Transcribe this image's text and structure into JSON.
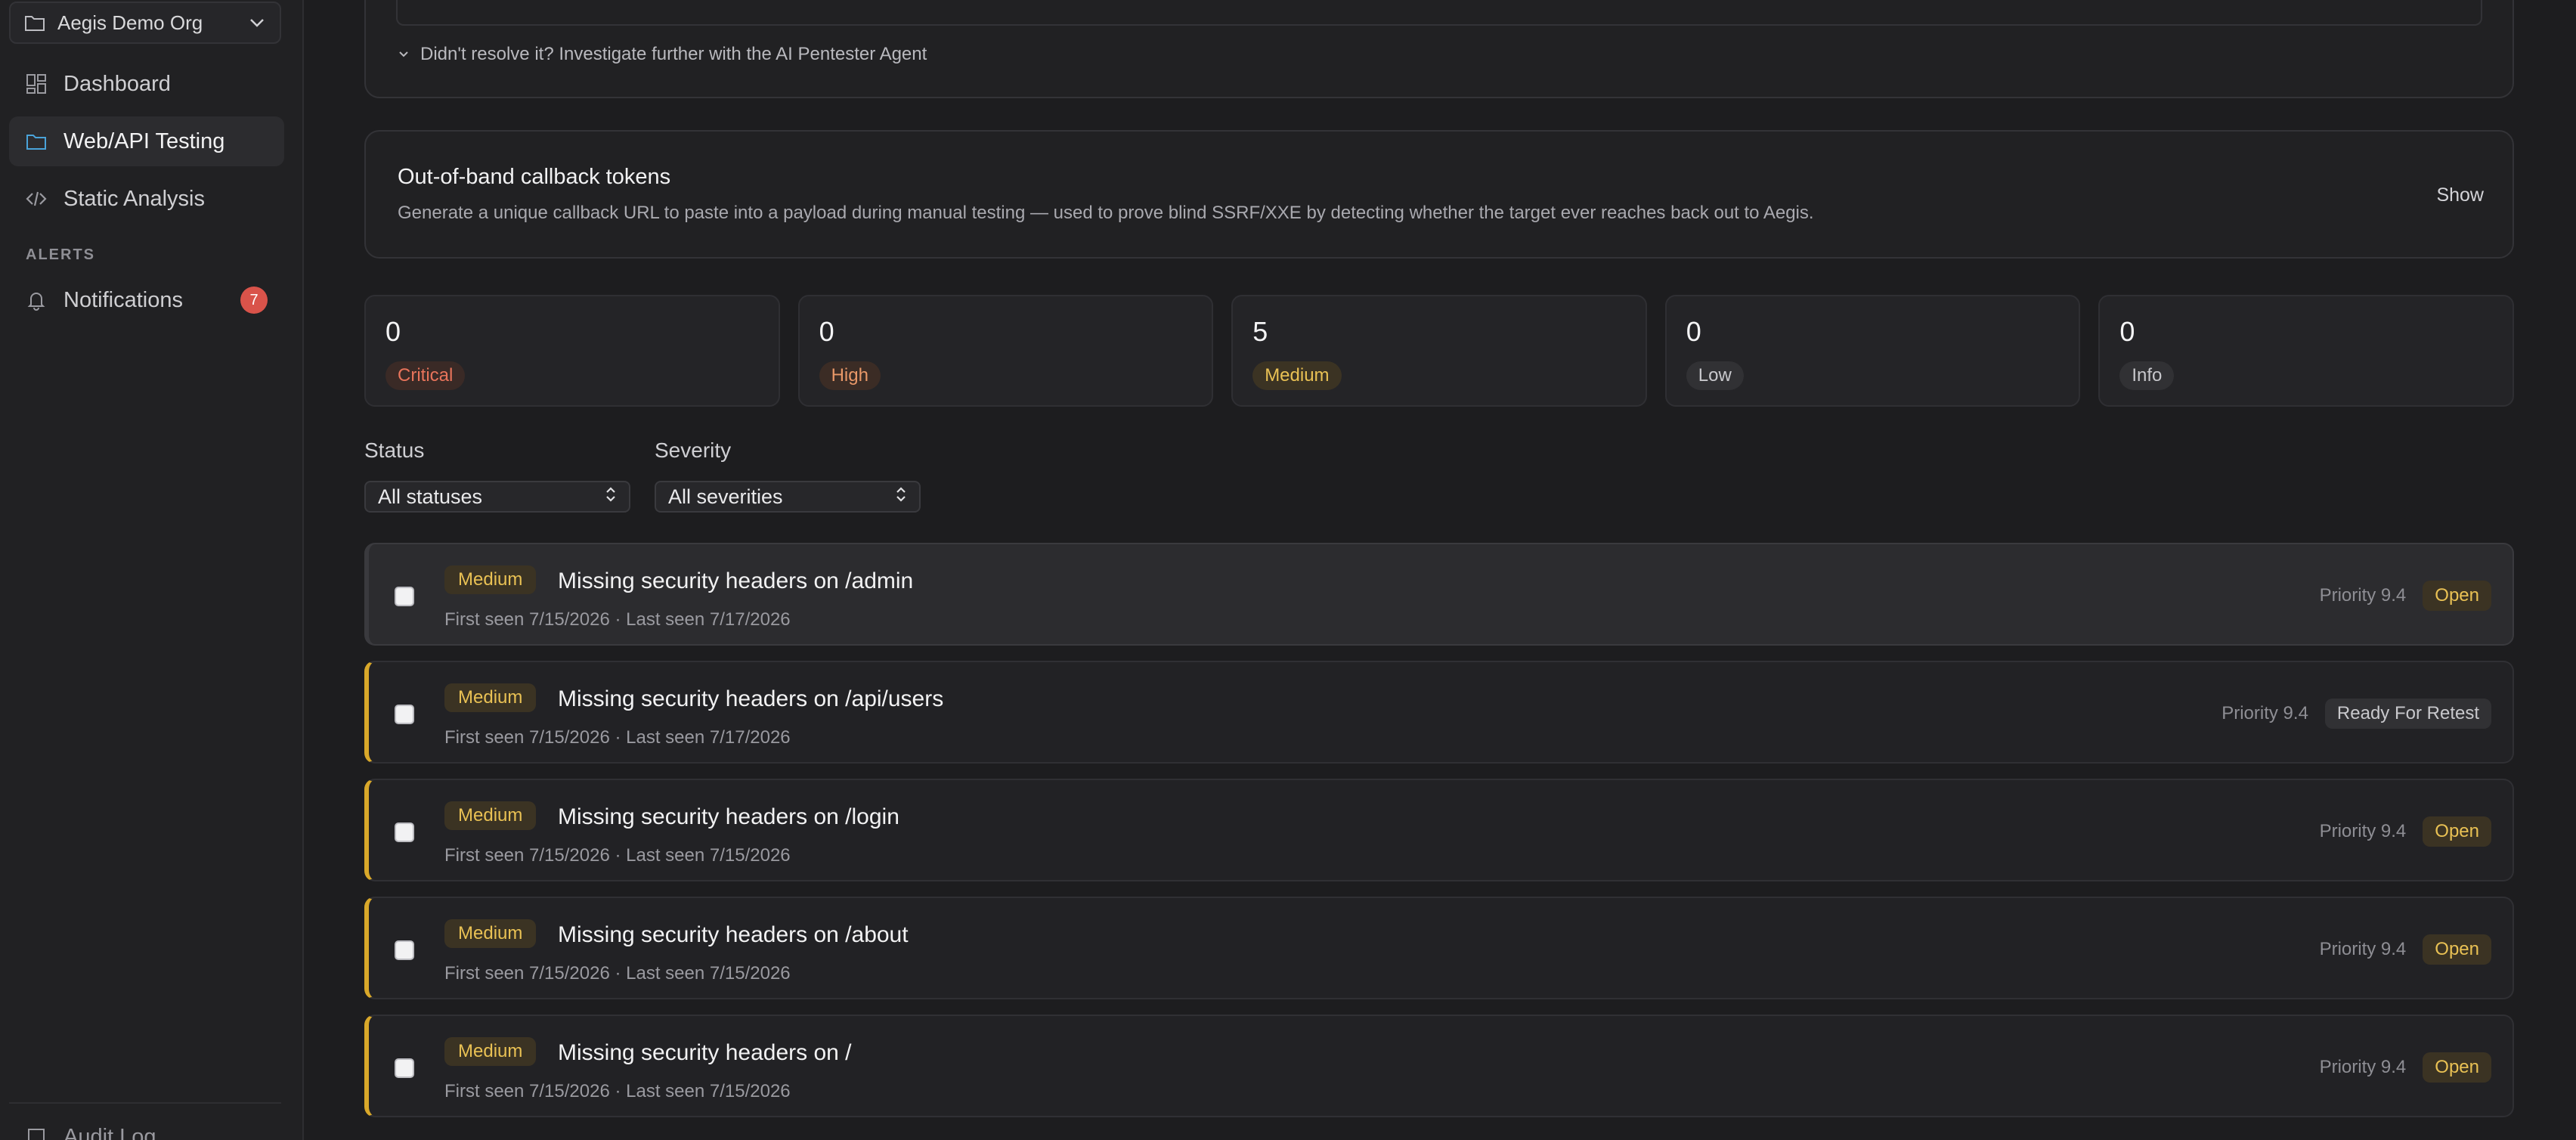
{
  "sidebar": {
    "org_name": "Aegis Demo Org",
    "nav": [
      {
        "label": "Dashboard",
        "icon": "dashboard-icon"
      },
      {
        "label": "Web/API Testing",
        "icon": "folder-icon",
        "active": true
      },
      {
        "label": "Static Analysis",
        "icon": "code-icon"
      }
    ],
    "alerts_section": "ALERTS",
    "notifications": {
      "label": "Notifications",
      "count": "7"
    },
    "bottom_item": "Audit Log"
  },
  "prev_card": {
    "investigate_text": "Didn't resolve it? Investigate further with the AI Pentester Agent"
  },
  "oob": {
    "title": "Out-of-band callback tokens",
    "description": "Generate a unique callback URL to paste into a payload during manual testing — used to prove blind SSRF/XXE by detecting whether the target ever reaches back out to Aegis.",
    "show_label": "Show"
  },
  "stats": [
    {
      "count": "0",
      "label": "Critical"
    },
    {
      "count": "0",
      "label": "High"
    },
    {
      "count": "5",
      "label": "Medium"
    },
    {
      "count": "0",
      "label": "Low"
    },
    {
      "count": "0",
      "label": "Info"
    }
  ],
  "filters": {
    "status_label": "Status",
    "status_value": "All statuses",
    "severity_label": "Severity",
    "severity_value": "All severities"
  },
  "findings": [
    {
      "severity": "Medium",
      "title": "Missing security headers on /admin",
      "meta": "First seen 7/15/2026 · Last seen 7/17/2026",
      "priority": "Priority 9.4",
      "status": "Open"
    },
    {
      "severity": "Medium",
      "title": "Missing security headers on /api/users",
      "meta": "First seen 7/15/2026 · Last seen 7/17/2026",
      "priority": "Priority 9.4",
      "status": "Ready For Retest"
    },
    {
      "severity": "Medium",
      "title": "Missing security headers on /login",
      "meta": "First seen 7/15/2026 · Last seen 7/15/2026",
      "priority": "Priority 9.4",
      "status": "Open"
    },
    {
      "severity": "Medium",
      "title": "Missing security headers on /about",
      "meta": "First seen 7/15/2026 · Last seen 7/15/2026",
      "priority": "Priority 9.4",
      "status": "Open"
    },
    {
      "severity": "Medium",
      "title": "Missing security headers on /",
      "meta": "First seen 7/15/2026 · Last seen 7/15/2026",
      "priority": "Priority 9.4",
      "status": "Open"
    }
  ],
  "colors": {
    "accent_medium": "#e9c154",
    "critical": "#e8745b",
    "notification_badge": "#d9534a"
  }
}
